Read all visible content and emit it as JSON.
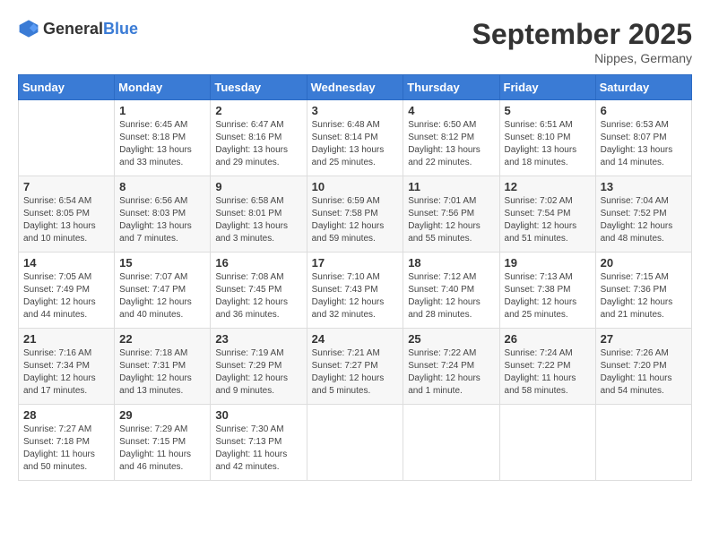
{
  "header": {
    "logo": {
      "general": "General",
      "blue": "Blue"
    },
    "title": "September 2025",
    "location": "Nippes, Germany"
  },
  "calendar": {
    "days_of_week": [
      "Sunday",
      "Monday",
      "Tuesday",
      "Wednesday",
      "Thursday",
      "Friday",
      "Saturday"
    ],
    "weeks": [
      [
        {
          "day": "",
          "info": ""
        },
        {
          "day": "1",
          "info": "Sunrise: 6:45 AM\nSunset: 8:18 PM\nDaylight: 13 hours\nand 33 minutes."
        },
        {
          "day": "2",
          "info": "Sunrise: 6:47 AM\nSunset: 8:16 PM\nDaylight: 13 hours\nand 29 minutes."
        },
        {
          "day": "3",
          "info": "Sunrise: 6:48 AM\nSunset: 8:14 PM\nDaylight: 13 hours\nand 25 minutes."
        },
        {
          "day": "4",
          "info": "Sunrise: 6:50 AM\nSunset: 8:12 PM\nDaylight: 13 hours\nand 22 minutes."
        },
        {
          "day": "5",
          "info": "Sunrise: 6:51 AM\nSunset: 8:10 PM\nDaylight: 13 hours\nand 18 minutes."
        },
        {
          "day": "6",
          "info": "Sunrise: 6:53 AM\nSunset: 8:07 PM\nDaylight: 13 hours\nand 14 minutes."
        }
      ],
      [
        {
          "day": "7",
          "info": "Sunrise: 6:54 AM\nSunset: 8:05 PM\nDaylight: 13 hours\nand 10 minutes."
        },
        {
          "day": "8",
          "info": "Sunrise: 6:56 AM\nSunset: 8:03 PM\nDaylight: 13 hours\nand 7 minutes."
        },
        {
          "day": "9",
          "info": "Sunrise: 6:58 AM\nSunset: 8:01 PM\nDaylight: 13 hours\nand 3 minutes."
        },
        {
          "day": "10",
          "info": "Sunrise: 6:59 AM\nSunset: 7:58 PM\nDaylight: 12 hours\nand 59 minutes."
        },
        {
          "day": "11",
          "info": "Sunrise: 7:01 AM\nSunset: 7:56 PM\nDaylight: 12 hours\nand 55 minutes."
        },
        {
          "day": "12",
          "info": "Sunrise: 7:02 AM\nSunset: 7:54 PM\nDaylight: 12 hours\nand 51 minutes."
        },
        {
          "day": "13",
          "info": "Sunrise: 7:04 AM\nSunset: 7:52 PM\nDaylight: 12 hours\nand 48 minutes."
        }
      ],
      [
        {
          "day": "14",
          "info": "Sunrise: 7:05 AM\nSunset: 7:49 PM\nDaylight: 12 hours\nand 44 minutes."
        },
        {
          "day": "15",
          "info": "Sunrise: 7:07 AM\nSunset: 7:47 PM\nDaylight: 12 hours\nand 40 minutes."
        },
        {
          "day": "16",
          "info": "Sunrise: 7:08 AM\nSunset: 7:45 PM\nDaylight: 12 hours\nand 36 minutes."
        },
        {
          "day": "17",
          "info": "Sunrise: 7:10 AM\nSunset: 7:43 PM\nDaylight: 12 hours\nand 32 minutes."
        },
        {
          "day": "18",
          "info": "Sunrise: 7:12 AM\nSunset: 7:40 PM\nDaylight: 12 hours\nand 28 minutes."
        },
        {
          "day": "19",
          "info": "Sunrise: 7:13 AM\nSunset: 7:38 PM\nDaylight: 12 hours\nand 25 minutes."
        },
        {
          "day": "20",
          "info": "Sunrise: 7:15 AM\nSunset: 7:36 PM\nDaylight: 12 hours\nand 21 minutes."
        }
      ],
      [
        {
          "day": "21",
          "info": "Sunrise: 7:16 AM\nSunset: 7:34 PM\nDaylight: 12 hours\nand 17 minutes."
        },
        {
          "day": "22",
          "info": "Sunrise: 7:18 AM\nSunset: 7:31 PM\nDaylight: 12 hours\nand 13 minutes."
        },
        {
          "day": "23",
          "info": "Sunrise: 7:19 AM\nSunset: 7:29 PM\nDaylight: 12 hours\nand 9 minutes."
        },
        {
          "day": "24",
          "info": "Sunrise: 7:21 AM\nSunset: 7:27 PM\nDaylight: 12 hours\nand 5 minutes."
        },
        {
          "day": "25",
          "info": "Sunrise: 7:22 AM\nSunset: 7:24 PM\nDaylight: 12 hours\nand 1 minute."
        },
        {
          "day": "26",
          "info": "Sunrise: 7:24 AM\nSunset: 7:22 PM\nDaylight: 11 hours\nand 58 minutes."
        },
        {
          "day": "27",
          "info": "Sunrise: 7:26 AM\nSunset: 7:20 PM\nDaylight: 11 hours\nand 54 minutes."
        }
      ],
      [
        {
          "day": "28",
          "info": "Sunrise: 7:27 AM\nSunset: 7:18 PM\nDaylight: 11 hours\nand 50 minutes."
        },
        {
          "day": "29",
          "info": "Sunrise: 7:29 AM\nSunset: 7:15 PM\nDaylight: 11 hours\nand 46 minutes."
        },
        {
          "day": "30",
          "info": "Sunrise: 7:30 AM\nSunset: 7:13 PM\nDaylight: 11 hours\nand 42 minutes."
        },
        {
          "day": "",
          "info": ""
        },
        {
          "day": "",
          "info": ""
        },
        {
          "day": "",
          "info": ""
        },
        {
          "day": "",
          "info": ""
        }
      ]
    ]
  }
}
